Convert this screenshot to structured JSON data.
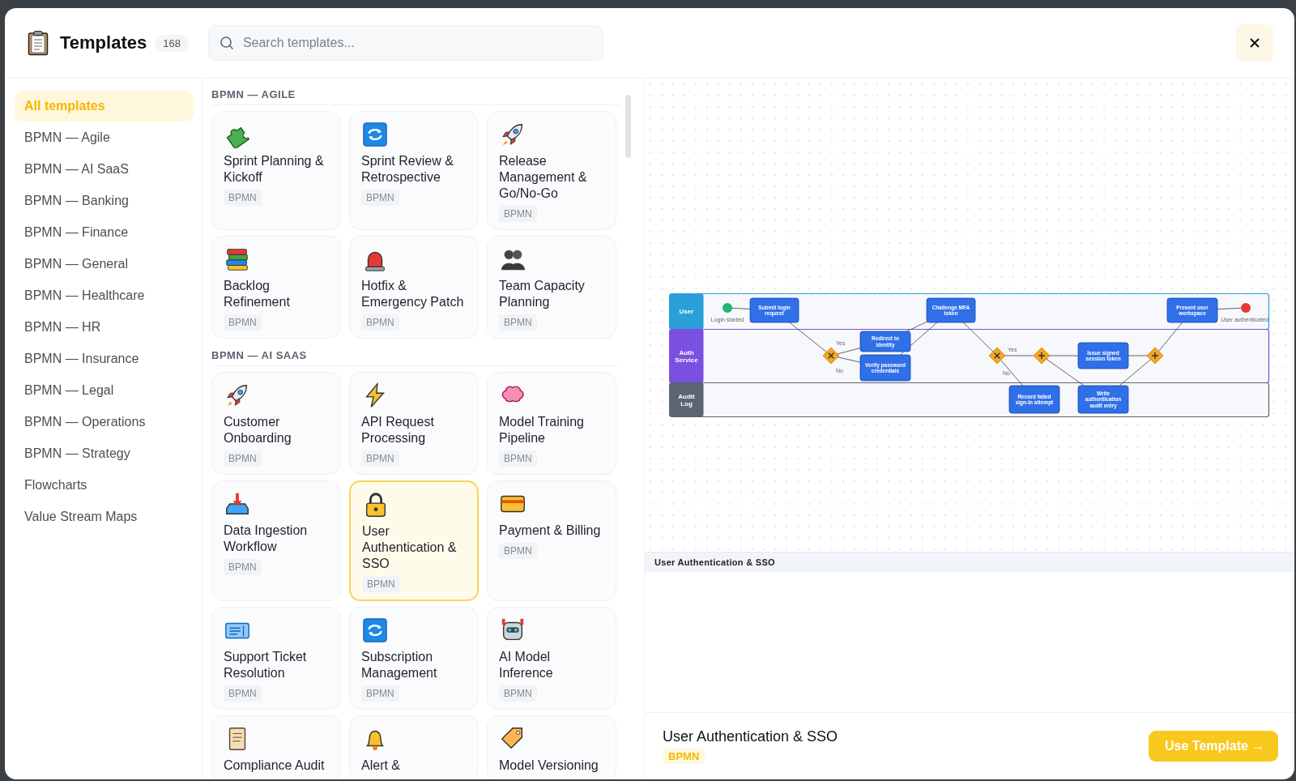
{
  "header": {
    "title": "Templates",
    "count": "168",
    "search": {
      "placeholder": "Search templates..."
    }
  },
  "sidebar": {
    "items": [
      {
        "label": "All templates",
        "selected": true
      },
      {
        "label": "BPMN — Agile",
        "selected": false
      },
      {
        "label": "BPMN — AI SaaS",
        "selected": false
      },
      {
        "label": "BPMN — Banking",
        "selected": false
      },
      {
        "label": "BPMN — Finance",
        "selected": false
      },
      {
        "label": "BPMN — General",
        "selected": false
      },
      {
        "label": "BPMN — Healthcare",
        "selected": false
      },
      {
        "label": "BPMN — HR",
        "selected": false
      },
      {
        "label": "BPMN — Insurance",
        "selected": false
      },
      {
        "label": "BPMN — Legal",
        "selected": false
      },
      {
        "label": "BPMN — Operations",
        "selected": false
      },
      {
        "label": "BPMN — Strategy",
        "selected": false
      },
      {
        "label": "Flowcharts",
        "selected": false
      },
      {
        "label": "Value Stream Maps",
        "selected": false
      }
    ]
  },
  "sections": [
    {
      "title": "BPMN — AGILE",
      "cards": [
        {
          "title": "Sprint Planning & Kickoff",
          "tag": "BPMN",
          "selected": false
        },
        {
          "title": "Sprint Review & Retrospective",
          "tag": "BPMN",
          "selected": false
        },
        {
          "title": "Release Management & Go/No-Go",
          "tag": "BPMN",
          "selected": false
        },
        {
          "title": "Backlog Refinement",
          "tag": "BPMN",
          "selected": false
        },
        {
          "title": "Hotfix & Emergency Patch",
          "tag": "BPMN",
          "selected": false
        },
        {
          "title": "Team Capacity Planning",
          "tag": "BPMN",
          "selected": false
        }
      ]
    },
    {
      "title": "BPMN — AI SAAS",
      "cards": [
        {
          "title": "Customer Onboarding",
          "tag": "BPMN",
          "selected": false
        },
        {
          "title": "API Request Processing",
          "tag": "BPMN",
          "selected": false
        },
        {
          "title": "Model Training Pipeline",
          "tag": "BPMN",
          "selected": false
        },
        {
          "title": "Data Ingestion Workflow",
          "tag": "BPMN",
          "selected": false
        },
        {
          "title": "User Authentication & SSO",
          "tag": "BPMN",
          "selected": true
        },
        {
          "title": "Payment & Billing",
          "tag": "BPMN",
          "selected": false
        },
        {
          "title": "Support Ticket Resolution",
          "tag": "BPMN",
          "selected": false
        },
        {
          "title": "Subscription Management",
          "tag": "BPMN",
          "selected": false
        },
        {
          "title": "AI Model Inference",
          "tag": "BPMN",
          "selected": false
        },
        {
          "title": "Compliance Audit",
          "selected": false
        },
        {
          "title": "Alert &",
          "selected": false
        },
        {
          "title": "Model Versioning",
          "selected": false
        }
      ]
    }
  ],
  "preview": {
    "diagram": {
      "lanes": [
        {
          "label": "User",
          "color": "#2b9fd8"
        },
        {
          "label": "Auth Service",
          "color": "#7a50e0"
        },
        {
          "label": "Audit Log",
          "color": "#5b6573"
        }
      ],
      "nodes": [
        {
          "kind": "start",
          "label": "Login started"
        },
        {
          "kind": "task",
          "label": "Submit login request"
        },
        {
          "kind": "gateway",
          "parallel": false
        },
        {
          "kind": "task",
          "label": "Redirect to identity"
        },
        {
          "kind": "task",
          "label": "Verify password credentials"
        },
        {
          "kind": "task",
          "label": "Challenge MFA token"
        },
        {
          "kind": "gateway",
          "parallel": false
        },
        {
          "kind": "gateway",
          "parallel": true
        },
        {
          "kind": "task",
          "label": "Issue signed session token"
        },
        {
          "kind": "gateway",
          "parallel": true
        },
        {
          "kind": "task",
          "label": "Present user workspace"
        },
        {
          "kind": "end",
          "label": "User authenticated"
        },
        {
          "kind": "task",
          "label": "Record failed sign-in attempt"
        },
        {
          "kind": "task",
          "label": "Write authentication audit entry"
        }
      ],
      "edge_labels": [
        "Yes",
        "No",
        "Yes",
        "No"
      ]
    },
    "caption": "User Authentication & SSO",
    "title": "User Authentication & SSO",
    "tag": "BPMN",
    "button": "Use Template →"
  }
}
